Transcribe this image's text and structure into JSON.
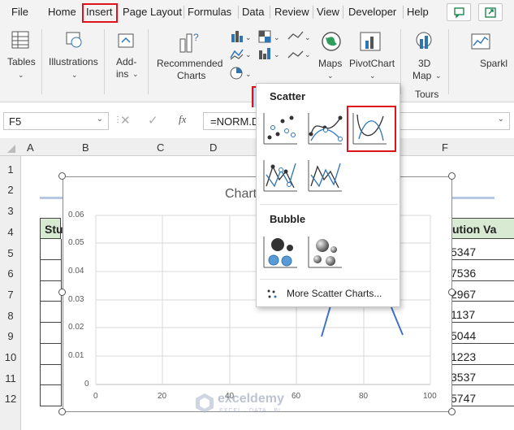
{
  "menu": {
    "tabs": [
      "File",
      "Home",
      "Insert",
      "Page Layout",
      "Formulas",
      "Data",
      "Review",
      "View",
      "Developer",
      "Help"
    ]
  },
  "ribbon": {
    "tables": "Tables",
    "illustrations": "Illustrations",
    "addins_line1": "Add-",
    "addins_line2": "ins",
    "recommended_line1": "Recommended",
    "recommended_line2": "Charts",
    "maps": "Maps",
    "pivotchart": "PivotChart",
    "map3d_line1": "3D",
    "map3d_line2": "Map",
    "tours": "Tours",
    "sparklines": "Sparkl"
  },
  "formula_bar": {
    "name_box": "F5",
    "fx": "fx",
    "formula": "=NORM.D"
  },
  "columns": [
    "A",
    "B",
    "C",
    "D",
    "F"
  ],
  "rows": [
    "1",
    "2",
    "3",
    "4",
    "5",
    "6",
    "7",
    "8",
    "9",
    "10",
    "11",
    "12"
  ],
  "sheet": {
    "header_left": "Stu",
    "header_right": "ution Va",
    "values": [
      "5347",
      "7536",
      "2967",
      "1137",
      "5044",
      "1223",
      "3537",
      "5747"
    ]
  },
  "chart": {
    "title": "Chart",
    "y_ticks": [
      "0.06",
      "0.05",
      "0.04",
      "0.03",
      "0.02",
      "0.01",
      "0"
    ],
    "x_ticks": [
      "0",
      "20",
      "40",
      "60",
      "80",
      "100"
    ]
  },
  "dropdown": {
    "scatter_title": "Scatter",
    "bubble_title": "Bubble",
    "more_link": "More Scatter Charts..."
  },
  "watermark": {
    "name": "exceldemy",
    "tagline": "EXCEL · DATA · BI"
  },
  "colors": {
    "accent_red": "#e0121b",
    "header_green": "#d9ead3",
    "line_blue": "#4472c4"
  }
}
